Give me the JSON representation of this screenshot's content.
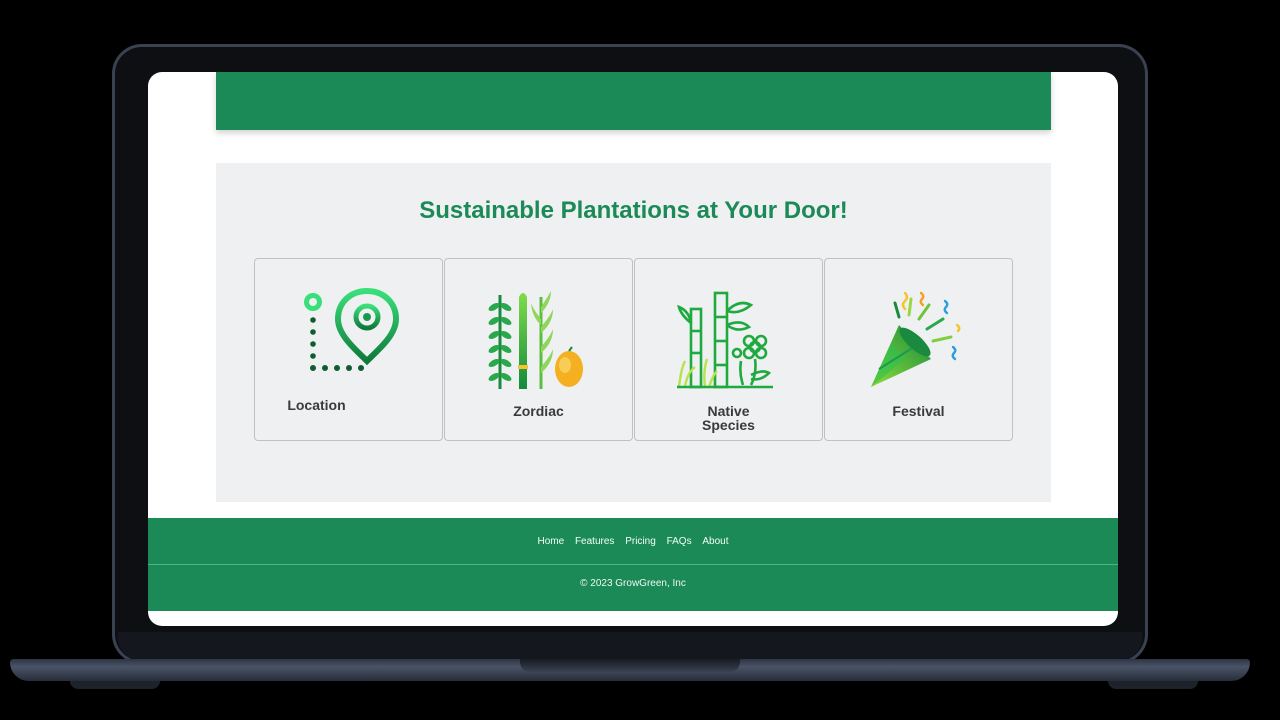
{
  "section": {
    "title": "Sustainable Plantations at Your Door!",
    "cards": [
      {
        "label": "Location",
        "icon": "map-pin-route-icon"
      },
      {
        "label": "Zordiac",
        "icon": "plants-lemon-icon"
      },
      {
        "label_line1": "Native",
        "label_line2": "Species",
        "icon": "bamboo-flower-icon"
      },
      {
        "label": "Festival",
        "icon": "party-popper-icon"
      }
    ]
  },
  "footer": {
    "nav": [
      "Home",
      "Features",
      "Pricing",
      "FAQs",
      "About"
    ],
    "copyright": "© 2023 GrowGreen, Inc"
  },
  "colors": {
    "brand_green": "#1b8a57",
    "section_bg": "#eff0f2"
  }
}
